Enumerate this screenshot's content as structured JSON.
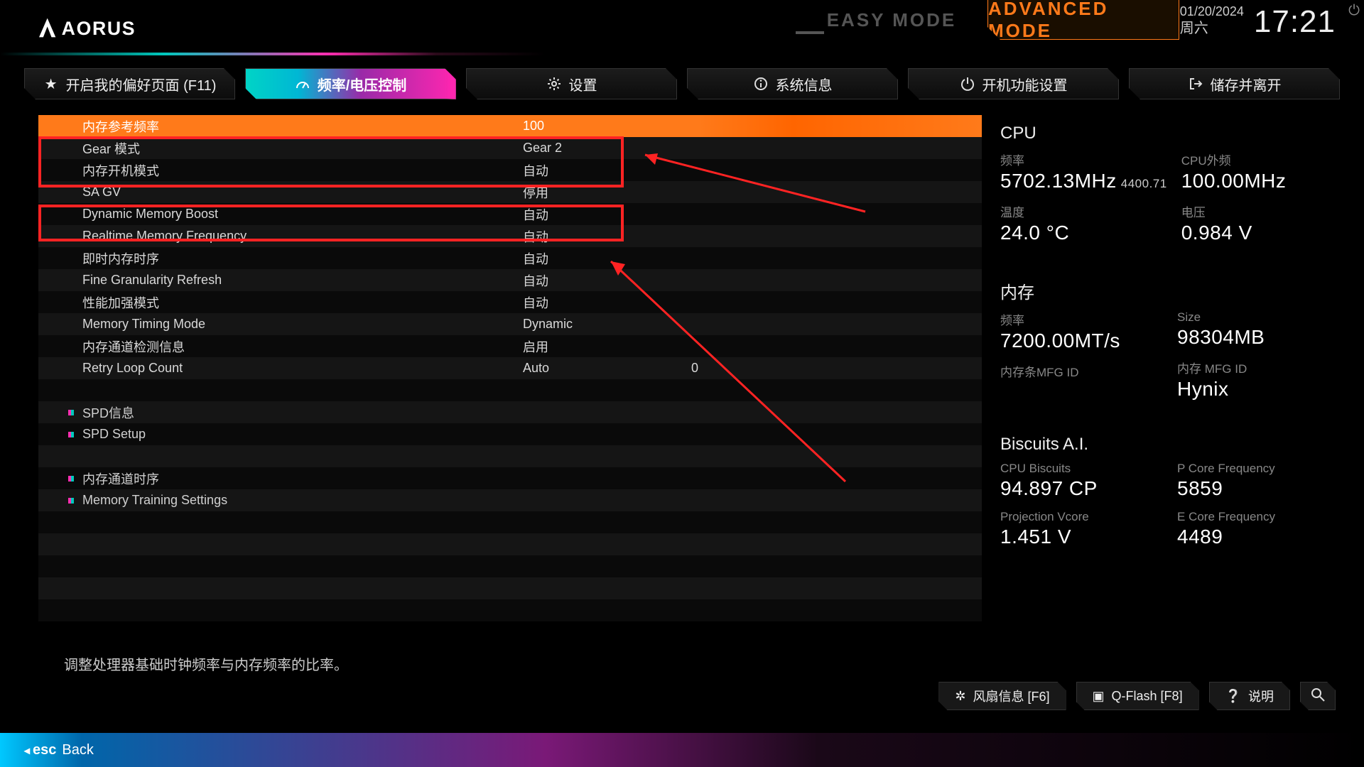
{
  "header": {
    "brand": "AORUS",
    "easy_mode": "EASY MODE",
    "adv_mode": "ADVANCED MODE",
    "date": "01/20/2024",
    "weekday": "周六",
    "time": "17:21"
  },
  "nav": {
    "fav": "开启我的偏好页面 (F11)",
    "tweak": "频率/电压控制",
    "settings": "设置",
    "sysinfo": "系统信息",
    "boot": "开机功能设置",
    "save": "储存并离开"
  },
  "rows": [
    {
      "label": "内存参考频率",
      "value": "100",
      "sel": true
    },
    {
      "label": "Gear 模式",
      "value": "Gear 2"
    },
    {
      "label": "内存开机模式",
      "value": "自动"
    },
    {
      "label": "SA GV",
      "value": "停用"
    },
    {
      "label": "Dynamic Memory Boost",
      "value": "自动"
    },
    {
      "label": "Realtime Memory Frequency",
      "value": "自动"
    },
    {
      "label": "即时内存时序",
      "value": "自动"
    },
    {
      "label": "Fine Granularity Refresh",
      "value": "自动"
    },
    {
      "label": "性能加强模式",
      "value": "自动"
    },
    {
      "label": "Memory Timing Mode",
      "value": "Dynamic"
    },
    {
      "label": "内存通道检测信息",
      "value": "启用"
    },
    {
      "label": "Retry Loop Count",
      "value": "Auto",
      "extra": "0"
    }
  ],
  "subs": [
    {
      "label": "SPD信息"
    },
    {
      "label": "SPD Setup"
    },
    {
      "label": ""
    },
    {
      "label": "内存通道时序"
    },
    {
      "label": "Memory Training Settings"
    }
  ],
  "help_text": "调整处理器基础时钟频率与内存频率的比率。",
  "side": {
    "cpu": {
      "title": "CPU",
      "freq_label": "频率",
      "freq": "5702.13MHz",
      "freq_sub": "4400.71",
      "bclk_label": "CPU外频",
      "bclk": "100.00MHz",
      "temp_label": "温度",
      "temp": "24.0 °C",
      "volt_label": "电压",
      "volt": "0.984 V"
    },
    "mem": {
      "title": "内存",
      "freq_label": "频率",
      "freq": "7200.00MT/s",
      "size_label": "Size",
      "size": "98304MB",
      "mfg1_label": "内存条MFG ID",
      "mfg1": "",
      "mfg2_label": "内存 MFG ID",
      "mfg2": "Hynix"
    },
    "ai": {
      "title": "Biscuits A.I.",
      "cpub_label": "CPU Biscuits",
      "cpub": "94.897 CP",
      "pcore_label": "P Core Frequency",
      "pcore": "5859",
      "pvcore_label": "Projection Vcore",
      "pvcore": "1.451 V",
      "ecore_label": "E Core Frequency",
      "ecore": "4489"
    }
  },
  "bottom": {
    "fan": "风扇信息 [F6]",
    "qflash": "Q-Flash [F8]",
    "help": "说明"
  },
  "footer": {
    "esc": "esc",
    "back": "Back"
  }
}
